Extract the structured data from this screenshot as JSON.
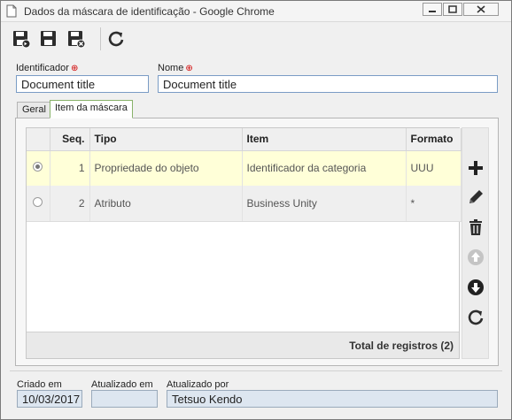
{
  "window": {
    "title": "Dados da máscara de identificação - Google Chrome"
  },
  "toolbar": {
    "buttons": [
      {
        "icon": "save-new-icon"
      },
      {
        "icon": "save-icon"
      },
      {
        "icon": "save-close-icon"
      },
      {
        "icon": "refresh-icon"
      }
    ]
  },
  "form": {
    "identificador_label": "Identificador",
    "identificador_value": "Document title",
    "nome_label": "Nome",
    "nome_value": "Document title",
    "required_mark": "⊕"
  },
  "tabs": [
    {
      "label": "Geral",
      "active": false
    },
    {
      "label": "Item da máscara",
      "active": true
    }
  ],
  "grid": {
    "columns": [
      "Seq.",
      "Tipo",
      "Item",
      "Formato"
    ],
    "rows": [
      {
        "selected": true,
        "seq": "1",
        "tipo": "Propriedade do objeto",
        "item": "Identificador da categoria",
        "formato": "UUU"
      },
      {
        "selected": false,
        "seq": "2",
        "tipo": "Atributo",
        "item": "Business Unity",
        "formato": "*"
      }
    ],
    "total_label": "Total de registros (2)"
  },
  "side_actions": [
    {
      "icon": "add-icon",
      "enabled": true
    },
    {
      "icon": "edit-icon",
      "enabled": true
    },
    {
      "icon": "delete-icon",
      "enabled": true
    },
    {
      "icon": "move-up-icon",
      "enabled": false
    },
    {
      "icon": "move-down-icon",
      "enabled": true
    },
    {
      "icon": "refresh-icon",
      "enabled": true
    }
  ],
  "footer": {
    "criado_label": "Criado em",
    "criado_value": "10/03/2017",
    "atualizado_label": "Atualizado em",
    "atualizado_value": "",
    "atualizado_por_label": "Atualizado por",
    "atualizado_por_value": "Tetsuo Kendo"
  },
  "colors": {
    "field_border": "#7a9cc5",
    "selected_row": "#ffffd8",
    "required": "#d00000"
  }
}
